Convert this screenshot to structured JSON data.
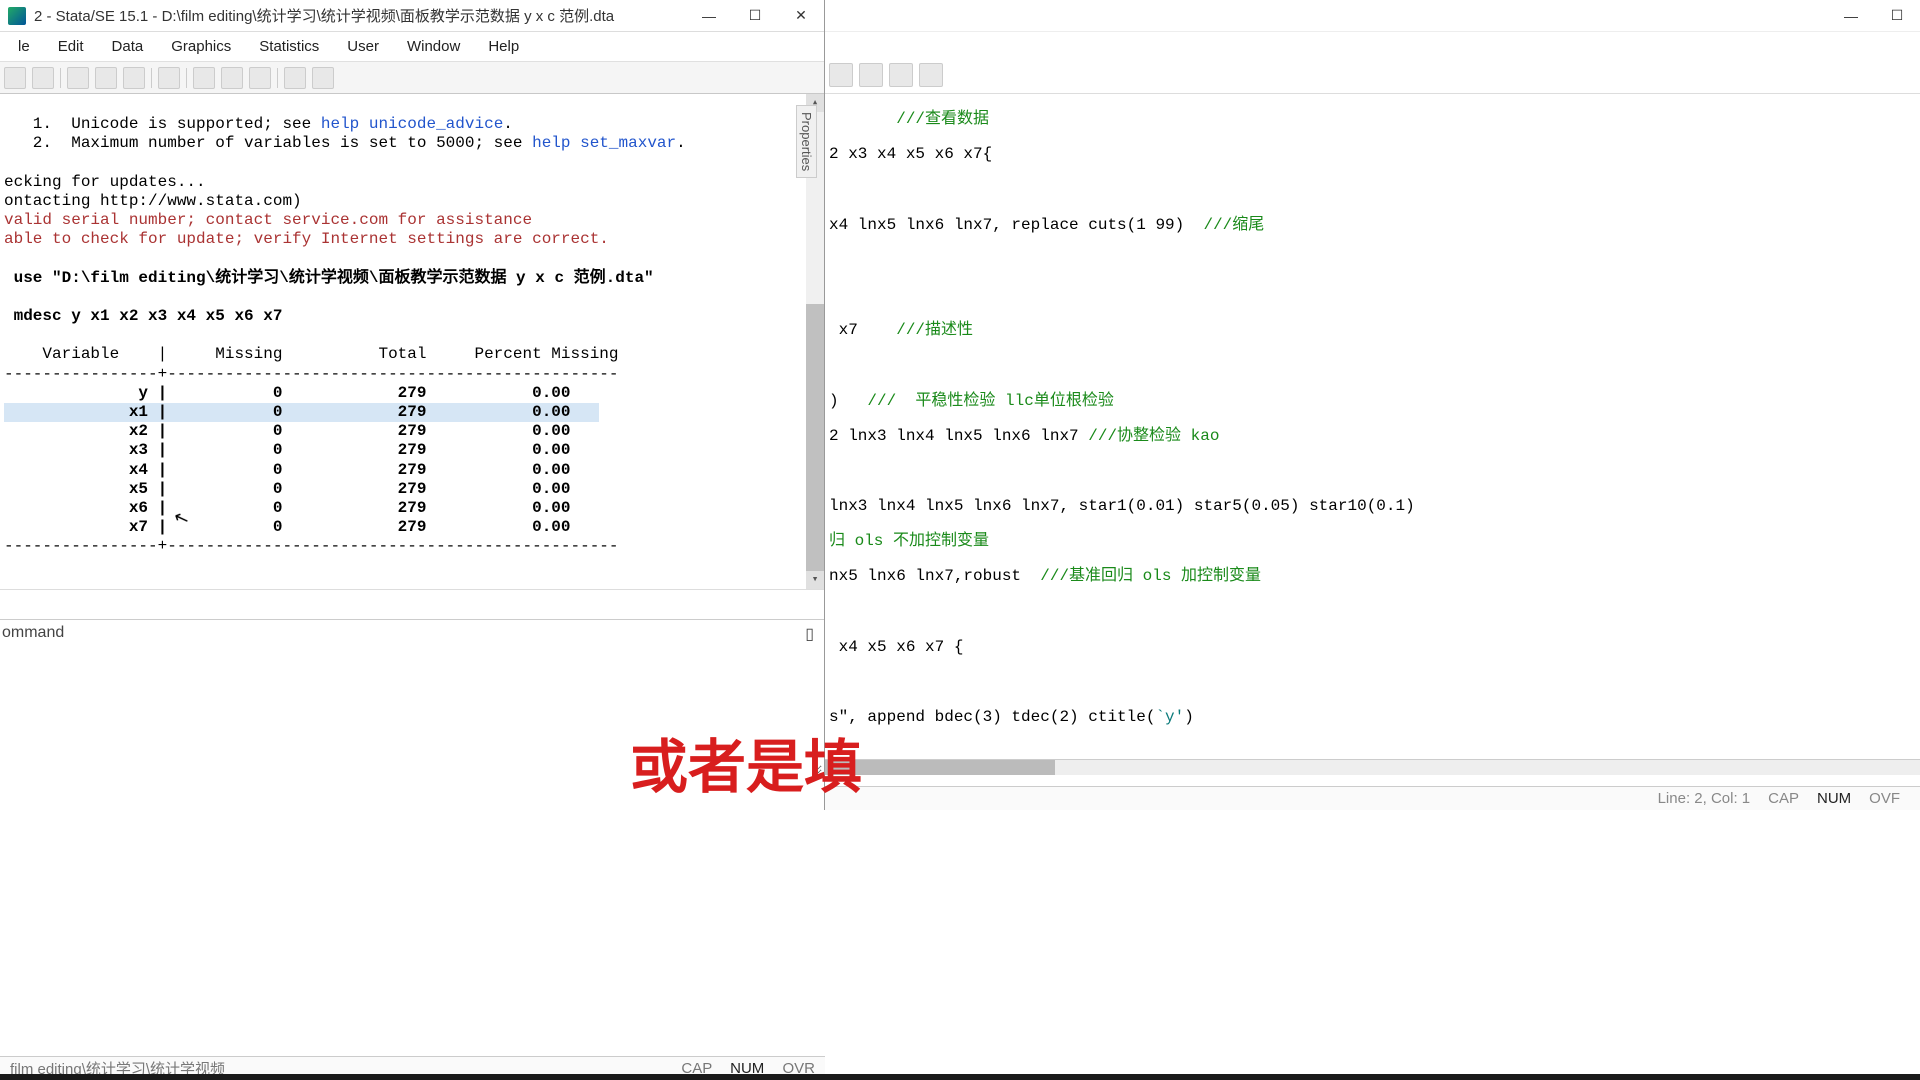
{
  "stata": {
    "title": "2 - Stata/SE 15.1 - D:\\film editing\\统计学习\\统计学视频\\面板教学示范数据 y x c 范例.dta",
    "menu": [
      "le",
      "Edit",
      "Data",
      "Graphics",
      "Statistics",
      "User",
      "Window",
      "Help"
    ],
    "results": {
      "l1p": "   1.  Unicode is supported; see ",
      "l1link": "help unicode_advice",
      "l1s": ".",
      "l2p": "   2.  Maximum number of variables is set to 5000; see ",
      "l2link": "help set_maxvar",
      "l2s": ".",
      "chk": "ecking for updates...",
      "contact": "ontacting http://www.stata.com)",
      "err1": "valid serial number; contact service.com for assistance",
      "err2": "able to check for update; verify Internet settings are correct.",
      "use": " use \"D:\\film editing\\统计学习\\统计学视频\\面板教学示范数据 y x c 范例.dta\"",
      "mdesc": " mdesc y x1 x2 x3 x4 x5 x6 x7",
      "thdr": "    Variable    |     Missing          Total     Percent Missing",
      "sep": "----------------+-----------------------------------------------",
      "rows": [
        "              y |           0            279           0.00",
        "             x1 |           0            279           0.00",
        "             x2 |           0            279           0.00",
        "             x3 |           0            279           0.00",
        "             x4 |           0            279           0.00",
        "             x5 |           0            279           0.00",
        "             x6 |           0            279           0.00",
        "             x7 |           0            279           0.00"
      ],
      "sep2": "----------------+-----------------------------------------------"
    },
    "cmd_label": "ommand",
    "status_path": "film editing\\统计学习\\统计学视频",
    "status_cap": "CAP",
    "status_num": "NUM",
    "status_ovr": "OVR"
  },
  "properties_label": "Properties",
  "do": {
    "lines": [
      {
        "t": "       ///查看数据",
        "g": true
      },
      {
        "t": "2 x3 x4 x5 x6 x7{",
        "g": false
      },
      {
        "t": "",
        "g": false
      },
      {
        "t": "x4 lnx5 lnx6 lnx7, replace cuts(1 99)  ",
        "g": false,
        "tail": "///缩尾"
      },
      {
        "t": "",
        "g": false
      },
      {
        "t": "",
        "g": false
      },
      {
        "t": " x7    ",
        "g": false,
        "tail": "///描述性"
      },
      {
        "t": "",
        "g": false
      },
      {
        "t": ")   ",
        "g": false,
        "tail": "///  平稳性检验 llc单位根检验"
      },
      {
        "t": "2 lnx3 lnx4 lnx5 lnx6 lnx7 ",
        "g": false,
        "tail": "///协整检验 kao"
      },
      {
        "t": "",
        "g": false
      },
      {
        "t": "lnx3 lnx4 lnx5 lnx6 lnx7, star1(0.01) star5(0.05) star10(0.1)",
        "g": false
      },
      {
        "t": "归 ols 不加控制变量",
        "g": true
      },
      {
        "t": "nx5 lnx6 lnx7,robust  ",
        "g": false,
        "tail": "///基准回归 ols 加控制变量"
      },
      {
        "t": "",
        "g": false
      },
      {
        "t": " x4 x5 x6 x7 {",
        "g": false
      },
      {
        "t": "",
        "g": false
      },
      {
        "t": "s\", append bdec(3) tdec(2) ctitle(",
        "g": false,
        "teal": "`y'",
        "suff": ")"
      }
    ],
    "status_line": "Line: 2, Col: 1",
    "status_cap": "CAP",
    "status_num": "NUM",
    "status_ovr": "OVF"
  },
  "overlay": "或者是填",
  "chart_data": {
    "type": "table",
    "title": "mdesc output",
    "columns": [
      "Variable",
      "Missing",
      "Total",
      "Percent Missing"
    ],
    "rows": [
      {
        "Variable": "y",
        "Missing": 0,
        "Total": 279,
        "Percent Missing": 0.0
      },
      {
        "Variable": "x1",
        "Missing": 0,
        "Total": 279,
        "Percent Missing": 0.0
      },
      {
        "Variable": "x2",
        "Missing": 0,
        "Total": 279,
        "Percent Missing": 0.0
      },
      {
        "Variable": "x3",
        "Missing": 0,
        "Total": 279,
        "Percent Missing": 0.0
      },
      {
        "Variable": "x4",
        "Missing": 0,
        "Total": 279,
        "Percent Missing": 0.0
      },
      {
        "Variable": "x5",
        "Missing": 0,
        "Total": 279,
        "Percent Missing": 0.0
      },
      {
        "Variable": "x6",
        "Missing": 0,
        "Total": 279,
        "Percent Missing": 0.0
      },
      {
        "Variable": "x7",
        "Missing": 0,
        "Total": 279,
        "Percent Missing": 0.0
      }
    ]
  }
}
